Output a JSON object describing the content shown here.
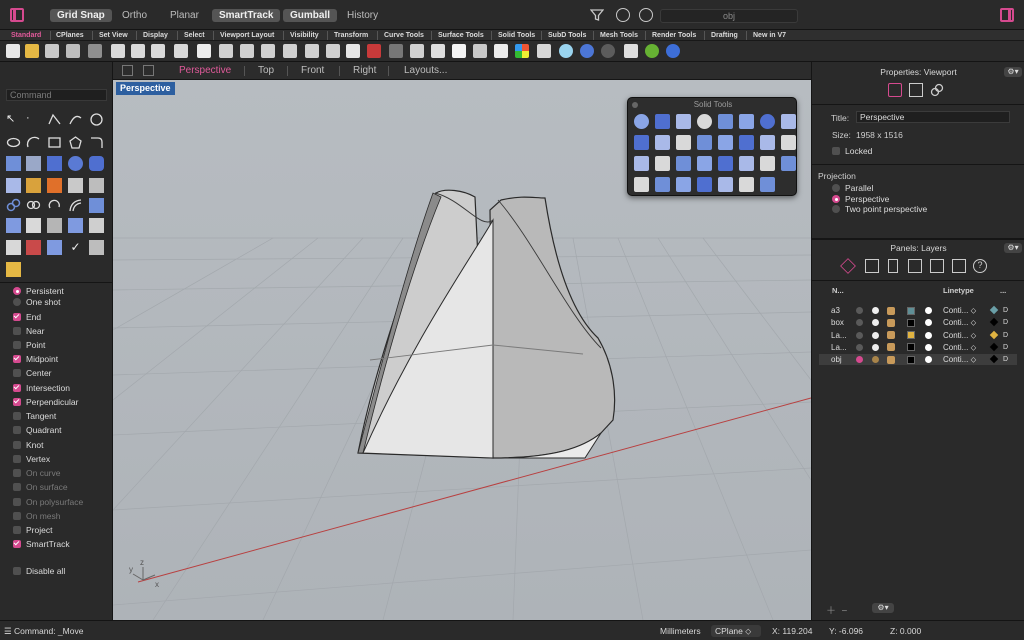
{
  "topbar": {
    "modes": [
      {
        "label": "Grid Snap",
        "on": true
      },
      {
        "label": "Ortho",
        "on": false
      },
      {
        "label": "Planar",
        "on": false
      },
      {
        "label": "SmartTrack",
        "on": true
      },
      {
        "label": "Gumball",
        "on": true
      },
      {
        "label": "History",
        "on": false
      }
    ],
    "search_value": "obj"
  },
  "toolbar_tabs": [
    "Standard",
    "CPlanes",
    "Set View",
    "Display",
    "Select",
    "Viewport Layout",
    "Visibility",
    "Transform",
    "Curve Tools",
    "Surface Tools",
    "Solid Tools",
    "SubD Tools",
    "Mesh Tools",
    "Render Tools",
    "Drafting",
    "New in V7"
  ],
  "active_tab": "Standard",
  "left": {
    "command_placeholder": "Command",
    "osnap_mode": [
      {
        "label": "Persistent",
        "checked": true
      },
      {
        "label": "One shot",
        "checked": false
      }
    ],
    "osnaps": [
      {
        "label": "End",
        "checked": true,
        "enabled": true
      },
      {
        "label": "Near",
        "checked": false,
        "enabled": true
      },
      {
        "label": "Point",
        "checked": false,
        "enabled": true
      },
      {
        "label": "Midpoint",
        "checked": true,
        "enabled": true
      },
      {
        "label": "Center",
        "checked": false,
        "enabled": true
      },
      {
        "label": "Intersection",
        "checked": true,
        "enabled": true
      },
      {
        "label": "Perpendicular",
        "checked": true,
        "enabled": true
      },
      {
        "label": "Tangent",
        "checked": false,
        "enabled": true
      },
      {
        "label": "Quadrant",
        "checked": false,
        "enabled": true
      },
      {
        "label": "Knot",
        "checked": false,
        "enabled": true
      },
      {
        "label": "Vertex",
        "checked": false,
        "enabled": true
      },
      {
        "label": "On curve",
        "checked": false,
        "enabled": false
      },
      {
        "label": "On surface",
        "checked": false,
        "enabled": false
      },
      {
        "label": "On polysurface",
        "checked": false,
        "enabled": false
      },
      {
        "label": "On mesh",
        "checked": false,
        "enabled": false
      },
      {
        "label": "Project",
        "checked": false,
        "enabled": true
      },
      {
        "label": "SmartTrack",
        "checked": true,
        "enabled": true
      }
    ],
    "disable_all": "Disable all"
  },
  "viewport_tabs": {
    "perspective": "Perspective",
    "top": "Top",
    "front": "Front",
    "right": "Right",
    "layouts": "Layouts..."
  },
  "viewport": {
    "label": "Perspective",
    "axis_z": "z",
    "axis_y": "y",
    "axis_x": "x"
  },
  "solid_tools": {
    "title": "Solid Tools"
  },
  "properties": {
    "header": "Properties: Viewport",
    "title_label": "Title:",
    "title_value": "Perspective",
    "size_label": "Size:",
    "size_value": "1958 x 1516",
    "locked_label": "Locked",
    "projection_label": "Projection",
    "projection_options": [
      {
        "label": "Parallel",
        "selected": false
      },
      {
        "label": "Perspective",
        "selected": true
      },
      {
        "label": "Two point perspective",
        "selected": false
      }
    ]
  },
  "layers": {
    "header": "Panels: Layers",
    "col_name": "N...",
    "col_linetype": "Linetype",
    "col_more": "...",
    "rows": [
      {
        "name": "a3",
        "linetype": "Conti... ⬦",
        "current": false,
        "swatch": "#5f8f96",
        "material": "#6a9fa7",
        "selected": false
      },
      {
        "name": "box",
        "linetype": "Conti... ⬦",
        "current": false,
        "swatch": "#000000",
        "material": "#000000",
        "selected": false
      },
      {
        "name": "La...",
        "linetype": "Conti... ⬦",
        "current": false,
        "swatch": "#e0b341",
        "material": "#e0b341",
        "selected": false
      },
      {
        "name": "La...",
        "linetype": "Conti... ⬦",
        "current": false,
        "swatch": "#000000",
        "material": "#000000",
        "selected": false
      },
      {
        "name": "obj",
        "linetype": "Conti... ⬦",
        "current": true,
        "swatch": "#000000",
        "material": "#000000",
        "selected": true
      }
    ]
  },
  "status": {
    "command": "Command: _Move",
    "units": "Millimeters",
    "cplane": "CPlane",
    "x": "X: 119.204",
    "y": "Y: -6.096",
    "z": "Z: 0.000"
  },
  "colors": {
    "accent": "#d54a8f",
    "viewport_bg": "#b4b9be",
    "label_blue": "#2d5fa0"
  }
}
